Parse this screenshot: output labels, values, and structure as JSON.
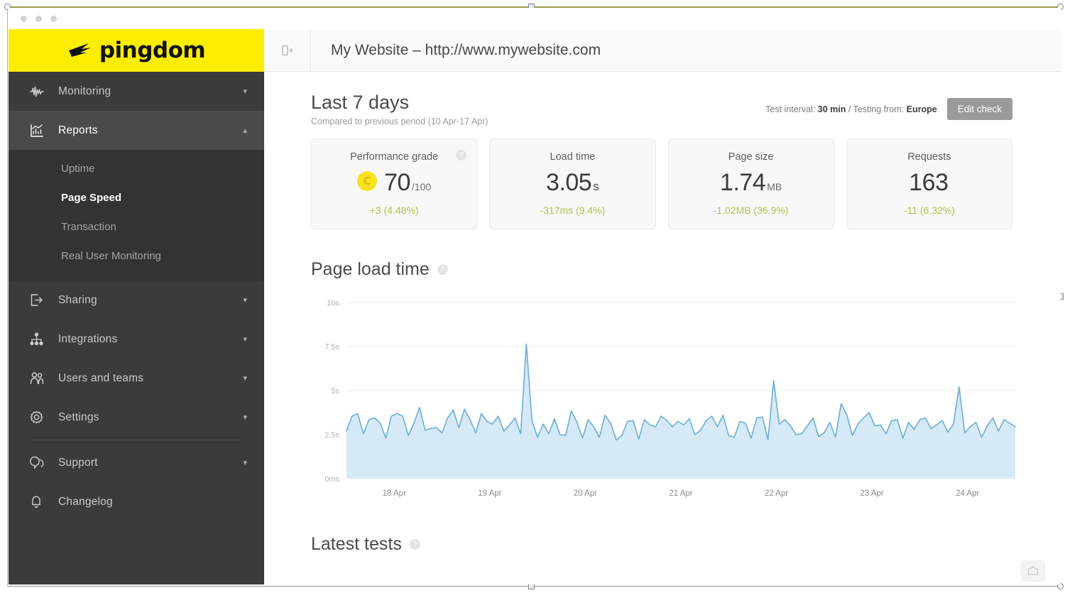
{
  "window": {
    "traffic_lights": [
      "close",
      "minimize",
      "zoom"
    ]
  },
  "brand": {
    "name": "pingdom",
    "logo_bg": "#FDED00",
    "logo_icon": "pingdom-mark-icon"
  },
  "sidebar": {
    "bg": "#3B3B3B",
    "items": [
      {
        "label": "Monitoring",
        "icon": "pulse-icon",
        "expandable": true,
        "expanded": false,
        "active": false
      },
      {
        "label": "Reports",
        "icon": "bar-chart-icon",
        "expandable": true,
        "expanded": true,
        "active": true
      },
      {
        "label": "Sharing",
        "icon": "share-export-icon",
        "expandable": true,
        "expanded": false,
        "active": false
      },
      {
        "label": "Integrations",
        "icon": "sitemap-icon",
        "expandable": true,
        "expanded": false,
        "active": false
      },
      {
        "label": "Users and teams",
        "icon": "users-icon",
        "expandable": true,
        "expanded": false,
        "active": false
      },
      {
        "label": "Settings",
        "icon": "gear-icon",
        "expandable": true,
        "expanded": false,
        "active": false
      },
      {
        "label": "Support",
        "icon": "chat-bubbles-icon",
        "expandable": true,
        "expanded": false,
        "active": false
      },
      {
        "label": "Changelog",
        "icon": "bell-icon",
        "expandable": false,
        "expanded": false,
        "active": false
      }
    ],
    "submenu": [
      {
        "label": "Uptime",
        "selected": false
      },
      {
        "label": "Page Speed",
        "selected": true
      },
      {
        "label": "Transaction",
        "selected": false
      },
      {
        "label": "Real User Monitoring",
        "selected": false
      }
    ],
    "chevron_down": "▾",
    "chevron_up": "▴"
  },
  "topbar": {
    "panel_toggle_icon": "panel-expand-icon",
    "site_title": "My Website – http://www.mywebsite.com"
  },
  "period": {
    "title": "Last 7 days",
    "subtitle": "Compared to previous period (10 Apr-17 Apr)",
    "interval_prefix": "Test interval:",
    "interval_value": "30 min",
    "separator": "/",
    "region_prefix": "Testing from:",
    "region_value": "Europe",
    "edit_button": "Edit check"
  },
  "cards": [
    {
      "label": "Performance grade",
      "grade": "C",
      "value": "70",
      "unit": "/100",
      "unit_small": true,
      "delta": "+3 (4.48%)",
      "delta_color": "#A8C64F",
      "has_help": true
    },
    {
      "label": "Load time",
      "grade": null,
      "value": "3.05",
      "unit": "s",
      "unit_small": false,
      "delta": "-317ms (9.4%)",
      "delta_color": "#A8C64F",
      "has_help": false
    },
    {
      "label": "Page size",
      "grade": null,
      "value": "1.74",
      "unit": "MB",
      "unit_small": true,
      "delta": "-1.02MB (36.9%)",
      "delta_color": "#A8C64F",
      "has_help": false
    },
    {
      "label": "Requests",
      "grade": null,
      "value": "163",
      "unit": "",
      "unit_small": true,
      "delta": "-11 (6.32%)",
      "delta_color": "#A8C64F",
      "has_help": false
    }
  ],
  "chart_section": {
    "title": "Page load time",
    "help_glyph": "?"
  },
  "latest_section": {
    "title": "Latest tests",
    "help_glyph": "?"
  },
  "chat_widget": {
    "icon": "chat-widget-icon"
  },
  "chart_data": {
    "type": "area",
    "title": "Page load time",
    "xlabel": "",
    "ylabel": "",
    "ylim": [
      0,
      10
    ],
    "ytick_labels": [
      "10s",
      "7.5s",
      "5s",
      "2.5s",
      "0ms"
    ],
    "ytick_values": [
      10,
      7.5,
      5,
      2.5,
      0
    ],
    "categories": [
      "18 Apr",
      "19 Apr",
      "20 Apr",
      "21 Apr",
      "22 Apr",
      "23 Apr",
      "24 Apr"
    ],
    "grid": true,
    "gridlines": [
      10,
      7.5,
      5,
      2.5
    ],
    "legend": null,
    "line_color": "#6BAED6",
    "fill_color": "#CFE5F5",
    "unit": "s",
    "series": [
      {
        "name": "Page load time",
        "values": [
          2.7,
          3.55,
          3.7,
          2.55,
          3.35,
          3.45,
          3.15,
          2.3,
          3.55,
          3.7,
          3.55,
          2.45,
          3.15,
          4.05,
          2.75,
          2.85,
          2.9,
          2.6,
          3.45,
          3.9,
          2.9,
          3.95,
          3.35,
          2.6,
          3.7,
          3.25,
          3.1,
          3.55,
          2.7,
          3.05,
          3.45,
          2.55,
          7.65,
          3.3,
          2.35,
          3.1,
          2.55,
          3.4,
          2.5,
          2.45,
          3.85,
          3.2,
          2.3,
          3.35,
          2.95,
          2.35,
          3.6,
          3.15,
          2.2,
          2.45,
          3.25,
          3.3,
          2.25,
          3.35,
          3.05,
          2.95,
          3.55,
          3.3,
          2.95,
          3.25,
          3.05,
          3.4,
          2.5,
          2.75,
          3.3,
          3.55,
          2.95,
          3.6,
          2.45,
          2.35,
          3.25,
          3.15,
          2.3,
          3.45,
          3.5,
          2.2,
          5.55,
          3.1,
          3.35,
          3.0,
          2.5,
          2.55,
          3.0,
          3.45,
          2.4,
          2.6,
          3.2,
          2.35,
          4.25,
          3.65,
          2.45,
          3.1,
          3.45,
          3.75,
          3.0,
          3.05,
          2.55,
          3.3,
          3.35,
          2.3,
          3.2,
          2.8,
          3.35,
          3.45,
          2.85,
          3.05,
          3.3,
          2.65,
          3.1,
          5.2,
          2.6,
          2.95,
          3.2,
          2.35,
          3.0,
          3.45,
          2.7,
          3.35,
          3.15,
          2.95
        ]
      }
    ]
  }
}
